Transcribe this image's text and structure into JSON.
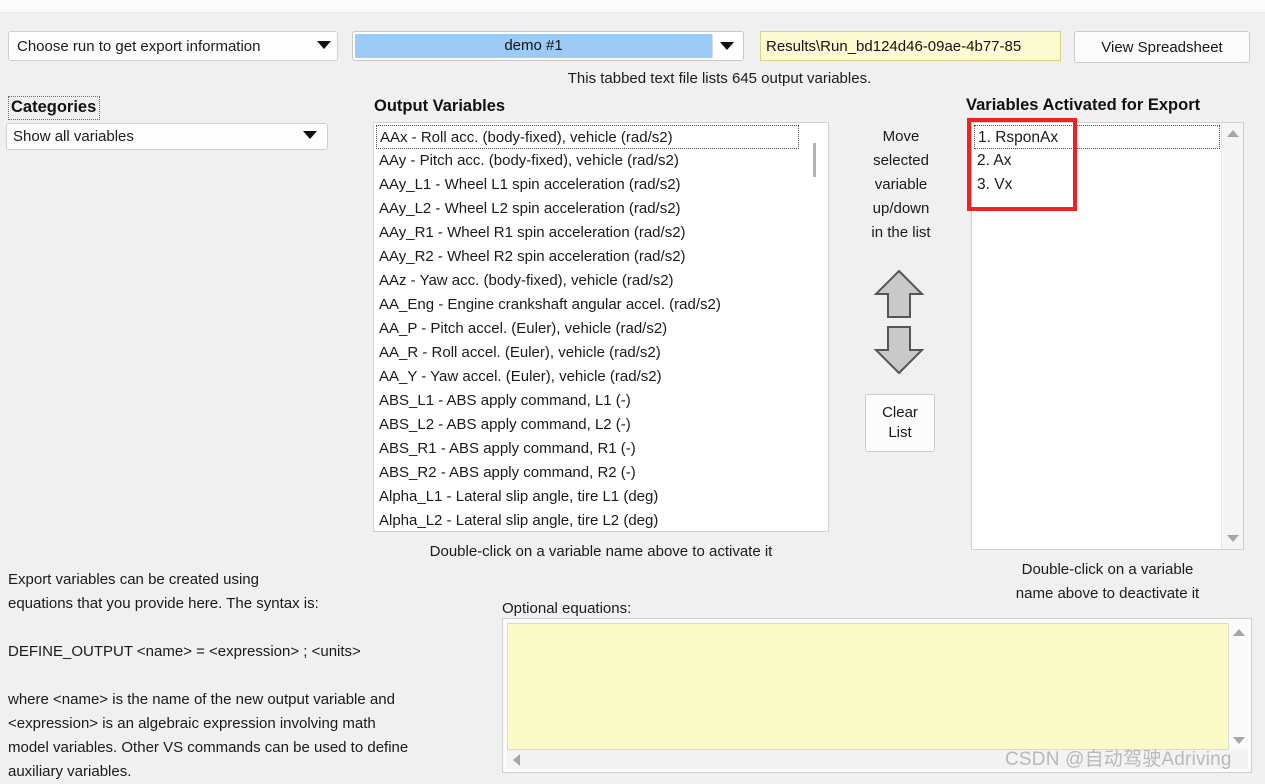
{
  "toolbar": {
    "run_selector_label": "Choose run to get export information",
    "run_name": "demo #1",
    "export_path": "Results\\Run_bd124d46-09ae-4b77-85",
    "view_spreadsheet_label": "View Spreadsheet",
    "file_note": "This tabbed text file lists 645 output variables."
  },
  "categories": {
    "label": "Categories",
    "selected": "Show all variables"
  },
  "output_variables": {
    "label": "Output Variables",
    "hint": "Double-click on a variable name above to activate it",
    "items": [
      "AAx - Roll acc. (body-fixed), vehicle (rad/s2)",
      "AAy - Pitch acc. (body-fixed), vehicle (rad/s2)",
      "AAy_L1 - Wheel L1 spin acceleration (rad/s2)",
      "AAy_L2 - Wheel L2 spin acceleration (rad/s2)",
      "AAy_R1 - Wheel R1 spin acceleration (rad/s2)",
      "AAy_R2 - Wheel R2 spin acceleration (rad/s2)",
      "AAz - Yaw acc. (body-fixed), vehicle (rad/s2)",
      "AA_Eng - Engine crankshaft angular accel. (rad/s2)",
      "AA_P - Pitch accel. (Euler), vehicle (rad/s2)",
      "AA_R - Roll accel. (Euler), vehicle (rad/s2)",
      "AA_Y - Yaw accel. (Euler), vehicle (rad/s2)",
      "ABS_L1 - ABS apply command, L1 (-)",
      "ABS_L2 - ABS apply command, L2 (-)",
      "ABS_R1 - ABS apply command, R1 (-)",
      "ABS_R2 - ABS apply command, R2 (-)",
      "Alpha_L1 - Lateral slip angle, tire L1 (deg)",
      "Alpha_L2 - Lateral slip angle, tire L2 (deg)"
    ]
  },
  "move_controls": {
    "caption_lines": [
      "Move",
      "selected",
      "variable",
      "up/down",
      "in the list"
    ],
    "up_icon": "arrow-up-icon",
    "down_icon": "arrow-down-icon",
    "clear_list_lines": [
      "Clear",
      "List"
    ]
  },
  "activated": {
    "label": "Variables Activated for Export",
    "items": [
      "1. RsponAx",
      "2. Ax",
      "3. Vx"
    ],
    "hint_lines": [
      "Double-click on a variable",
      "name above to deactivate it"
    ],
    "highlight_color": "#ee2222"
  },
  "help": {
    "lines": [
      "Export variables can be created using",
      "equations that you provide here. The syntax is:",
      "",
      "DEFINE_OUTPUT <name> = <expression> ; <units>",
      "",
      "where <name> is the name of the new output variable and",
      "<expression> is an algebraic expression involving math",
      "model variables. Other VS commands can be used to define",
      "auxiliary variables."
    ]
  },
  "equations": {
    "label": "Optional equations:",
    "value": "",
    "placeholder": ""
  },
  "watermark": "CSDN @自动驾驶Adriving"
}
